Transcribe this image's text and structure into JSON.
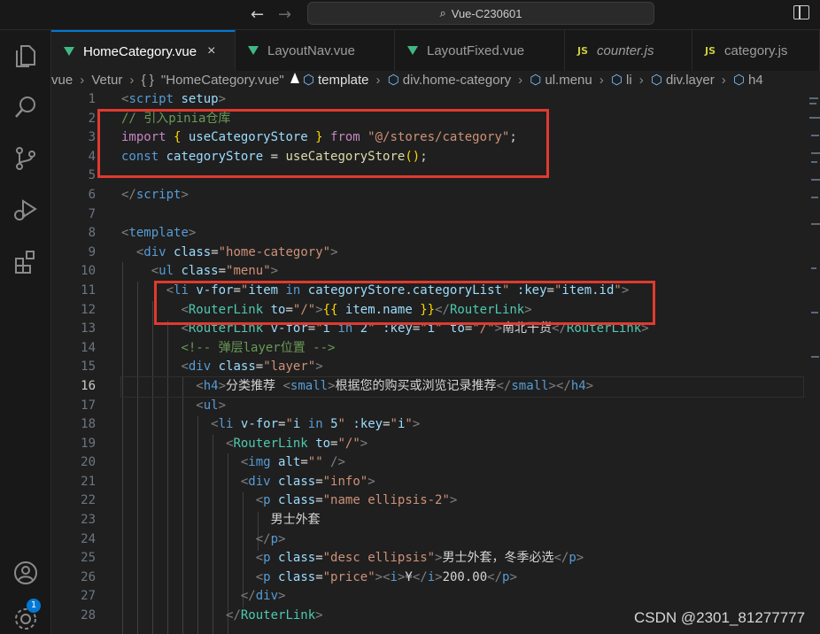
{
  "window": {
    "title": "Vue-C230601"
  },
  "tabs": [
    {
      "label": "HomeCategory.vue",
      "kind": "vue",
      "active": true
    },
    {
      "label": "LayoutNav.vue",
      "kind": "vue"
    },
    {
      "label": "LayoutFixed.vue",
      "kind": "vue"
    },
    {
      "label": "counter.js",
      "kind": "js",
      "italic": true
    },
    {
      "label": "category.js",
      "kind": "js"
    }
  ],
  "breadcrumb": {
    "items": [
      "vue",
      "Vetur",
      "\"HomeCategory.vue\"",
      "template",
      "div.home-category",
      "ul.menu",
      "li",
      "div.layer",
      "h4"
    ],
    "braces": "{ }"
  },
  "icons": {
    "js_mark": "JS",
    "close": "×",
    "back": "←",
    "forward": "→",
    "search": "⌕"
  },
  "activity_badge": "1",
  "editor": {
    "current_line": 16,
    "line_numbers": [
      "1",
      "2",
      "3",
      "4",
      "5",
      "6",
      "7",
      "8",
      "9",
      "10",
      "11",
      "12",
      "13",
      "14",
      "15",
      "16",
      "17",
      "18",
      "19",
      "20",
      "21",
      "22",
      "23",
      "24",
      "25",
      "26",
      "27",
      "28"
    ]
  },
  "code": {
    "l1": [
      "<",
      "script",
      " ",
      "setup",
      ">"
    ],
    "l2": [
      "// 引入pinia仓库"
    ],
    "l3": [
      "import",
      " ",
      "{ ",
      "useCategoryStore",
      " }",
      " from ",
      "\"@/stores/category\"",
      ";"
    ],
    "l4": [
      "const",
      " ",
      "categoryStore",
      " = ",
      "useCategoryStore",
      "()",
      ";"
    ],
    "l7": [
      "</",
      "script",
      ">"
    ],
    "l8": [
      "<",
      "template",
      ">"
    ],
    "l9": [
      "<",
      "div",
      " ",
      "class",
      "=",
      "\"home-category\"",
      ">"
    ],
    "l10": [
      "<",
      "ul",
      " ",
      "class",
      "=",
      "\"menu\"",
      ">"
    ],
    "l11": [
      "<",
      "li",
      " ",
      "v-for",
      "=",
      "\"",
      "item",
      " in ",
      "categoryStore.categoryList",
      "\"",
      " ",
      ":key",
      "=",
      "\"",
      "item.id",
      "\"",
      ">"
    ],
    "l12": [
      "<",
      "RouterLink",
      " ",
      "to",
      "=",
      "\"/\"",
      ">",
      "{{",
      " item.name ",
      "}}",
      "</",
      "RouterLink",
      ">"
    ],
    "l13": [
      "<",
      "RouterLink",
      " ",
      "v-for",
      "=",
      "\"",
      "i",
      " in ",
      "2",
      "\"",
      " ",
      ":key",
      "=",
      "\"",
      "i",
      "\"",
      " ",
      "to",
      "=",
      "\"/\"",
      ">",
      "南北干货",
      "</",
      "RouterLink",
      ">"
    ],
    "l14": [
      "<!-- 弹层layer位置 -->"
    ],
    "l15": [
      "<",
      "div",
      " ",
      "class",
      "=",
      "\"layer\"",
      ">"
    ],
    "l16": [
      "<",
      "h4",
      ">",
      "分类推荐 ",
      "<",
      "small",
      ">",
      "根据您的购买或浏览记录推荐",
      "</",
      "small",
      ">",
      "</",
      "h4",
      ">"
    ],
    "l17": [
      "<",
      "ul",
      ">"
    ],
    "l18": [
      "<",
      "li",
      " ",
      "v-for",
      "=",
      "\"",
      "i",
      " in ",
      "5",
      "\"",
      " ",
      ":key",
      "=",
      "\"",
      "i",
      "\"",
      ">"
    ],
    "l19": [
      "<",
      "RouterLink",
      " ",
      "to",
      "=",
      "\"/\"",
      ">"
    ],
    "l20": [
      "<",
      "img",
      " ",
      "alt",
      "=",
      "\"\"",
      " />"
    ],
    "l21": [
      "<",
      "div",
      " ",
      "class",
      "=",
      "\"info\"",
      ">"
    ],
    "l22": [
      "<",
      "p",
      " ",
      "class",
      "=",
      "\"name ellipsis-2\"",
      ">"
    ],
    "l23": [
      "男士外套"
    ],
    "l24": [
      "</",
      "p",
      ">"
    ],
    "l25": [
      "<",
      "p",
      " ",
      "class",
      "=",
      "\"desc ellipsis\"",
      ">",
      "男士外套，冬季必选",
      "</",
      "p",
      ">"
    ],
    "l26": [
      "<",
      "p",
      " ",
      "class",
      "=",
      "\"price\"",
      ">",
      "<",
      "i",
      ">",
      "¥",
      "</",
      "i",
      ">",
      "200.00",
      "</",
      "p",
      ">"
    ],
    "l27": [
      "</",
      "div",
      ">"
    ],
    "l28": [
      "</",
      "RouterLink",
      ">"
    ]
  },
  "watermark": "CSDN @2301_81277777",
  "colors": {
    "highlight_box": "#e03a2f",
    "vue_green": "#41b883",
    "accent": "#0078d4"
  }
}
